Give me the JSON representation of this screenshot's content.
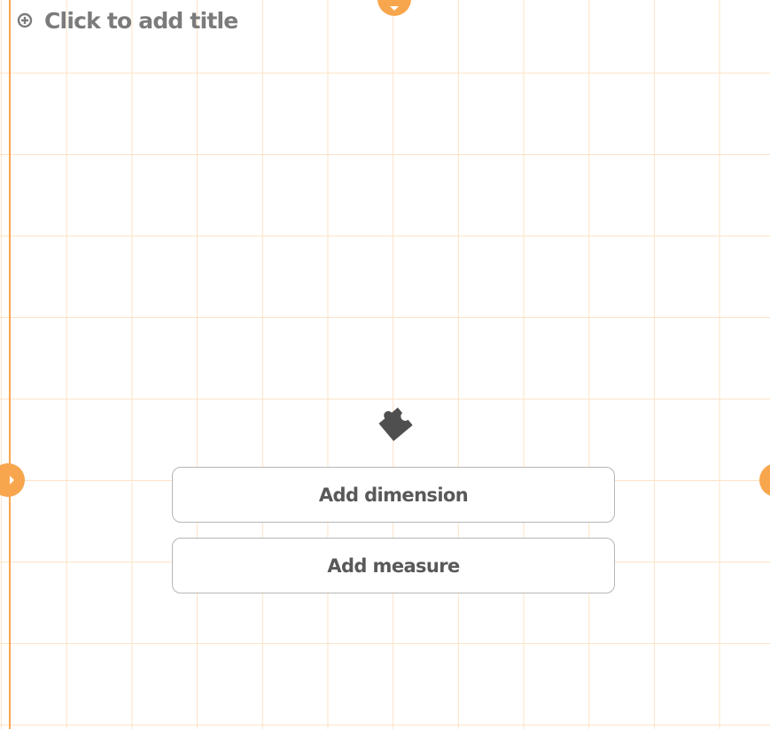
{
  "title": {
    "placeholder_text": "Click to add title",
    "icon": "plus-circle-icon"
  },
  "chart_placeholder": {
    "icon": "puzzle-piece-icon",
    "add_dimension_label": "Add dimension",
    "add_measure_label": "Add measure"
  },
  "resize_handles": [
    "top",
    "left",
    "right"
  ],
  "colors": {
    "accent": "#f8a64e",
    "grid_line": "#fde3c7",
    "title_text": "#7b7b7b",
    "button_text": "#595959",
    "button_border": "#b6b6b6",
    "icon": "#4f4f4f"
  }
}
